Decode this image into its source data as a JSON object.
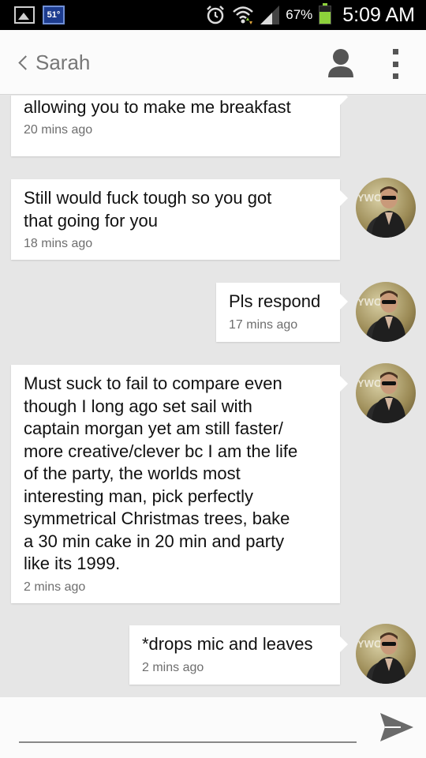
{
  "status_bar": {
    "temperature": "51°",
    "battery_percent": "67%",
    "battery_level": 0.67,
    "time": "5:09 AM",
    "icons": [
      "gallery-icon",
      "weather-icon",
      "alarm-icon",
      "wifi-icon",
      "signal-icon",
      "battery-icon"
    ]
  },
  "header": {
    "contact_name": "Sarah",
    "icons": [
      "back-chevron-icon",
      "contact-person-icon",
      "overflow-menu-icon"
    ]
  },
  "messages": [
    {
      "text": "response, I'll have yo reconsider\nallowing you to make me breakfast",
      "time": "20 mins ago",
      "avatar": false
    },
    {
      "text": "Still would fuck tough so you got\nthat going for you",
      "time": "18 mins ago",
      "avatar": true
    },
    {
      "text": "Pls respond",
      "time": "17 mins ago",
      "avatar": true
    },
    {
      "text": "Must suck to fail to compare even\nthough I long ago set sail with\ncaptain morgan yet am still faster/\nmore creative/clever bc I am the life\nof the party, the worlds most\ninteresting man, pick perfectly\nsymmetrical Christmas trees, bake\na 30 min cake in 20 min and party\nlike its 1999.",
      "time": "2 mins ago",
      "avatar": true
    },
    {
      "text": "*drops mic and leaves",
      "time": "2 mins ago",
      "avatar": true
    }
  ],
  "composer": {
    "input_value": "",
    "input_placeholder": "",
    "send_icon": "send-arrow-icon"
  },
  "colors": {
    "background": "#e6e6e6",
    "bubble": "#ffffff",
    "battery_green": "#8ed13b",
    "header_text": "#777777"
  }
}
